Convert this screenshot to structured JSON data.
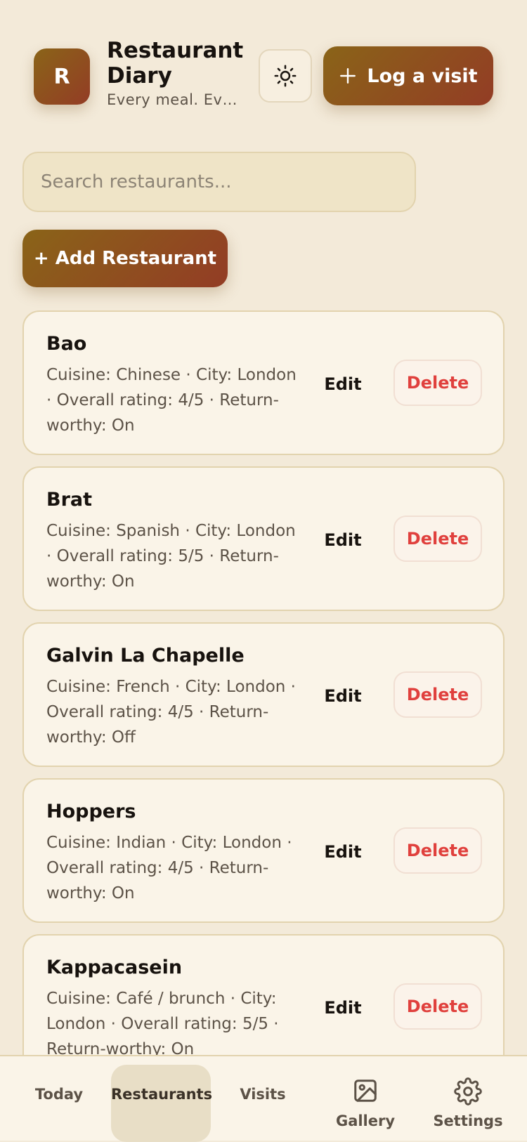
{
  "header": {
    "logo_letter": "R",
    "title": "Restaurant Diary",
    "subtitle": "Every meal. Eve...",
    "theme_toggle_icon": "sun-icon",
    "log_visit_label": "Log a visit"
  },
  "search": {
    "placeholder": "Search restaurants..."
  },
  "add_button_label": "+ Add Restaurant",
  "restaurants": [
    {
      "name": "Bao",
      "meta": "Cuisine: Chinese · City: London · Overall rating: 4/5 · Return-worthy: On",
      "edit": "Edit",
      "delete": "Delete"
    },
    {
      "name": "Brat",
      "meta": "Cuisine: Spanish · City: London · Overall rating: 5/5 · Return-worthy: On",
      "edit": "Edit",
      "delete": "Delete"
    },
    {
      "name": "Galvin La Chapelle",
      "meta": "Cuisine: French · City: London · Overall rating: 4/5 · Return-worthy: Off",
      "edit": "Edit",
      "delete": "Delete"
    },
    {
      "name": "Hoppers",
      "meta": "Cuisine: Indian · City: London · Overall rating: 4/5 · Return-worthy: On",
      "edit": "Edit",
      "delete": "Delete"
    },
    {
      "name": "Kappacasein",
      "meta": "Cuisine: Café / brunch · City: London · Overall rating: 5/5 · Return-worthy: On",
      "edit": "Edit",
      "delete": "Delete"
    }
  ],
  "nav": {
    "items": [
      {
        "label": "Today",
        "icon": "",
        "active": false
      },
      {
        "label": "Restaurants",
        "icon": "",
        "active": true
      },
      {
        "label": "Visits",
        "icon": "",
        "active": false
      },
      {
        "label": "Gallery",
        "icon": "image-icon",
        "active": false
      },
      {
        "label": "Settings",
        "icon": "gear-icon",
        "active": false
      }
    ]
  },
  "colors": {
    "background": "#f3ead9",
    "accent_start": "#8a6418",
    "accent_end": "#933c25",
    "danger": "#e0403d"
  }
}
